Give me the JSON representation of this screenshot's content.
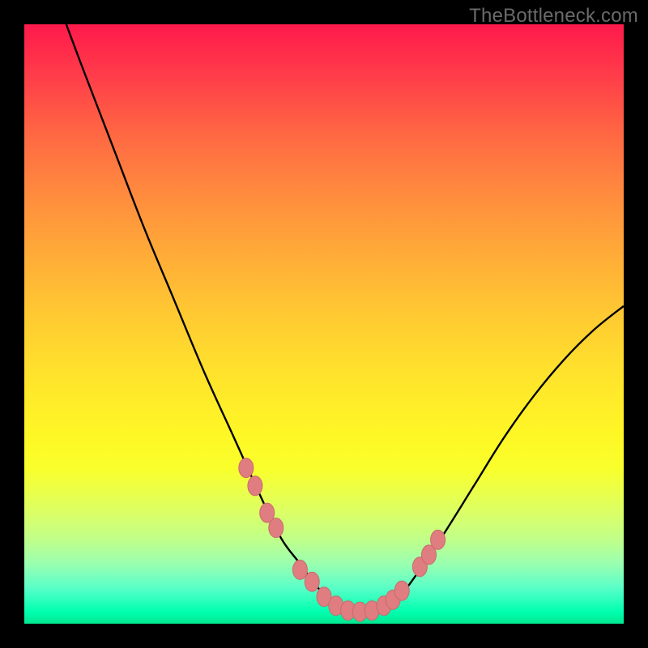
{
  "watermark": "TheBottleneck.com",
  "colors": {
    "frame": "#000000",
    "curve": "#000000",
    "marker_fill": "#e07d80",
    "marker_stroke": "#c96a6e",
    "gradient_top": "#ff1a4b",
    "gradient_mid": "#ffe22c",
    "gradient_bottom": "#00e890"
  },
  "chart_data": {
    "type": "line",
    "title": "",
    "xlabel": "",
    "ylabel": "",
    "xlim": [
      0,
      100
    ],
    "ylim": [
      0,
      100
    ],
    "note": "Axes unlabeled; x/y expressed as 0–100 percent of plot width/height (y=0 bottom, y=100 top). Values estimated from pixels.",
    "series": [
      {
        "name": "curve",
        "x": [
          7,
          10,
          15,
          20,
          25,
          30,
          35,
          40,
          43,
          46,
          49,
          52,
          55,
          58,
          62,
          66,
          70,
          75,
          80,
          85,
          90,
          95,
          100
        ],
        "y": [
          100,
          92,
          79,
          66,
          54,
          42,
          31,
          20,
          14,
          10,
          6,
          3,
          2,
          2,
          4,
          9,
          15,
          23,
          31,
          38,
          44,
          49,
          53
        ]
      }
    ],
    "markers": {
      "name": "highlighted-points",
      "x": [
        37,
        38.5,
        40.5,
        42,
        46,
        48,
        50,
        52,
        54,
        56,
        58,
        60,
        61.5,
        63,
        66,
        67.5,
        69
      ],
      "y": [
        26,
        23,
        18.5,
        16,
        9,
        7,
        4.5,
        3,
        2.2,
        2,
        2.2,
        3,
        4,
        5.5,
        9.5,
        11.5,
        14
      ]
    }
  }
}
